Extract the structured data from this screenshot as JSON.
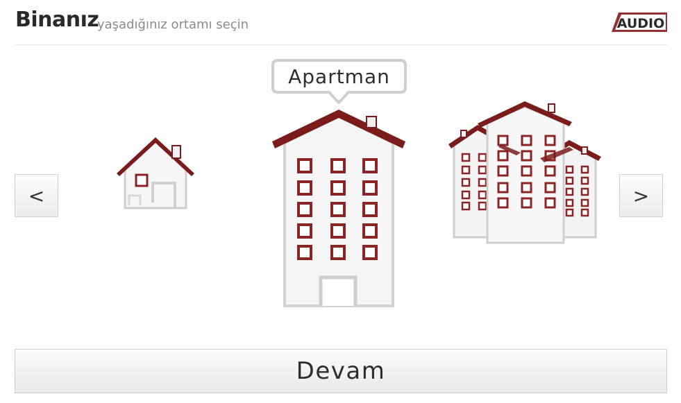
{
  "header": {
    "title": "Binanız",
    "subtitle": "yaşadığınız ortamı seçin",
    "logo_text": "AUDIO"
  },
  "nav": {
    "prev_label": "<",
    "next_label": ">"
  },
  "selection": {
    "selected_label": "Apartman",
    "options": [
      "house",
      "apartment",
      "complex"
    ],
    "selected_index": 1
  },
  "continue_button": {
    "label": "Devam"
  },
  "colors": {
    "roof": "#7a1c1c",
    "window": "#8b2525",
    "wall": "#f4f4f4",
    "accent": "#8b1a1a"
  }
}
